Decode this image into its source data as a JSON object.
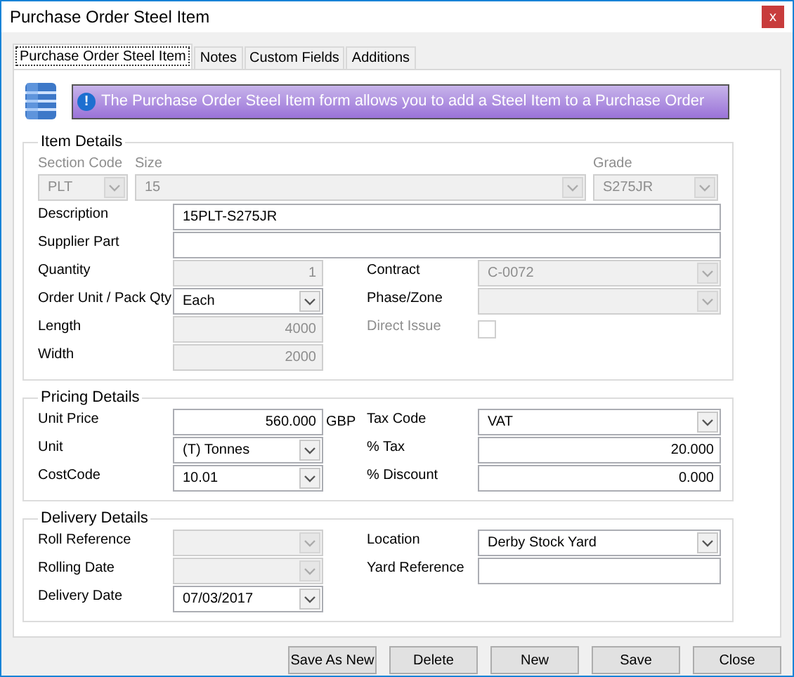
{
  "window": {
    "title": "Purchase Order Steel Item",
    "close": "x"
  },
  "tabs": [
    {
      "label": "Purchase Order Steel Item",
      "selected": true
    },
    {
      "label": "Notes",
      "selected": false
    },
    {
      "label": "Custom Fields",
      "selected": false
    },
    {
      "label": "Additions",
      "selected": false
    }
  ],
  "banner": {
    "icon": "!",
    "text": "The Purchase Order Steel Item form allows you to add a Steel Item to a Purchase Order"
  },
  "item_details": {
    "title": "Item Details",
    "header_fields": [
      {
        "label": "Section Code",
        "value": "PLT",
        "disabled": true
      },
      {
        "label": "Size",
        "value": "15",
        "disabled": true
      },
      {
        "label": "Grade",
        "value": "S275JR",
        "disabled": true
      }
    ],
    "wide_fields": [
      {
        "label": "Description",
        "value": "15PLT-S275JR",
        "disabled": false
      },
      {
        "label": "Supplier Part",
        "disabled": false
      }
    ],
    "left_fields": [
      {
        "label": "Quantity",
        "kind": "number",
        "value": "1",
        "disabled": true
      },
      {
        "label": "Order Unit / Pack Qty",
        "kind": "combo",
        "value": "Each",
        "disabled": false
      },
      {
        "label": "Length",
        "kind": "number",
        "value": "4000",
        "disabled": true
      },
      {
        "label": "Width",
        "kind": "number",
        "value": "2000",
        "disabled": true
      }
    ],
    "right_fields": [
      {
        "label": "Contract",
        "kind": "combo",
        "value": "C-0072",
        "disabled": true
      },
      {
        "label": "Phase/Zone",
        "kind": "combo",
        "disabled": true
      },
      {
        "label": "Direct Issue",
        "kind": "check",
        "checked": false,
        "disabled": true
      }
    ]
  },
  "pricing_details": {
    "title": "Pricing Details",
    "left_fields": [
      {
        "label": "Unit Price",
        "kind": "number",
        "value": "560.000",
        "suffix": "GBP",
        "disabled": false
      },
      {
        "label": "Unit",
        "kind": "combo",
        "value": "(T) Tonnes",
        "disabled": false
      },
      {
        "label": "CostCode",
        "kind": "combo",
        "value": "10.01",
        "disabled": false
      }
    ],
    "right_fields": [
      {
        "label": "Tax Code",
        "kind": "combo",
        "value": "VAT",
        "disabled": false
      },
      {
        "label": "% Tax",
        "kind": "number",
        "value": "20.000",
        "disabled": false
      },
      {
        "label": "% Discount",
        "kind": "number",
        "value": "0.000",
        "disabled": false
      }
    ]
  },
  "delivery_details": {
    "title": "Delivery Details",
    "left_fields": [
      {
        "label": "Roll Reference",
        "kind": "combo",
        "disabled": true
      },
      {
        "label": "Rolling Date",
        "kind": "combo",
        "disabled": true
      },
      {
        "label": "Delivery Date",
        "kind": "combo",
        "value": "07/03/2017",
        "disabled": false
      }
    ],
    "right_fields": [
      {
        "label": "Location",
        "kind": "combo",
        "value": "Derby Stock Yard",
        "disabled": false
      },
      {
        "label": "Yard Reference",
        "kind": "text",
        "disabled": false
      }
    ]
  },
  "buttons": [
    "Save As New",
    "Delete",
    "New",
    "Save",
    "Close"
  ]
}
